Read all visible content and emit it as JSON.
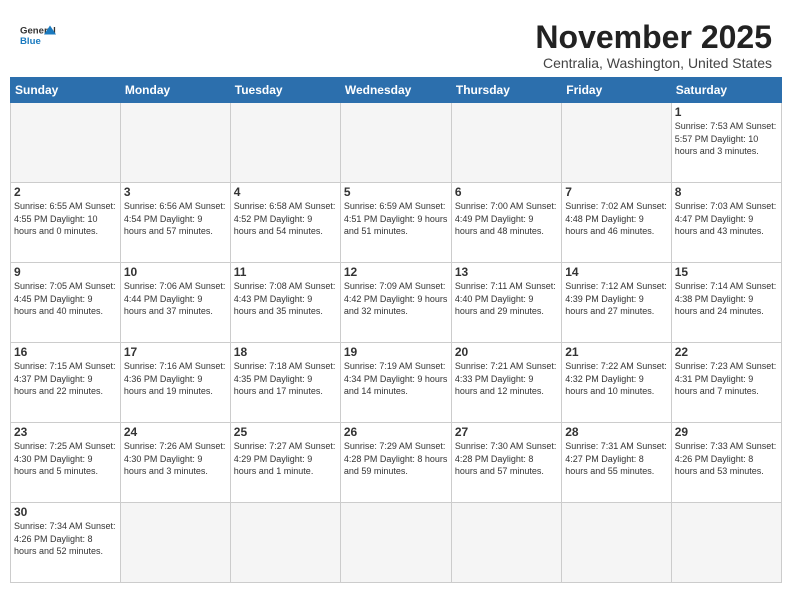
{
  "header": {
    "logo_general": "General",
    "logo_blue": "Blue",
    "month_title": "November 2025",
    "subtitle": "Centralia, Washington, United States"
  },
  "weekdays": [
    "Sunday",
    "Monday",
    "Tuesday",
    "Wednesday",
    "Thursday",
    "Friday",
    "Saturday"
  ],
  "weeks": [
    [
      {
        "day": "",
        "info": ""
      },
      {
        "day": "",
        "info": ""
      },
      {
        "day": "",
        "info": ""
      },
      {
        "day": "",
        "info": ""
      },
      {
        "day": "",
        "info": ""
      },
      {
        "day": "",
        "info": ""
      },
      {
        "day": "1",
        "info": "Sunrise: 7:53 AM\nSunset: 5:57 PM\nDaylight: 10 hours and 3 minutes."
      }
    ],
    [
      {
        "day": "2",
        "info": "Sunrise: 6:55 AM\nSunset: 4:55 PM\nDaylight: 10 hours and 0 minutes."
      },
      {
        "day": "3",
        "info": "Sunrise: 6:56 AM\nSunset: 4:54 PM\nDaylight: 9 hours and 57 minutes."
      },
      {
        "day": "4",
        "info": "Sunrise: 6:58 AM\nSunset: 4:52 PM\nDaylight: 9 hours and 54 minutes."
      },
      {
        "day": "5",
        "info": "Sunrise: 6:59 AM\nSunset: 4:51 PM\nDaylight: 9 hours and 51 minutes."
      },
      {
        "day": "6",
        "info": "Sunrise: 7:00 AM\nSunset: 4:49 PM\nDaylight: 9 hours and 48 minutes."
      },
      {
        "day": "7",
        "info": "Sunrise: 7:02 AM\nSunset: 4:48 PM\nDaylight: 9 hours and 46 minutes."
      },
      {
        "day": "8",
        "info": "Sunrise: 7:03 AM\nSunset: 4:47 PM\nDaylight: 9 hours and 43 minutes."
      }
    ],
    [
      {
        "day": "9",
        "info": "Sunrise: 7:05 AM\nSunset: 4:45 PM\nDaylight: 9 hours and 40 minutes."
      },
      {
        "day": "10",
        "info": "Sunrise: 7:06 AM\nSunset: 4:44 PM\nDaylight: 9 hours and 37 minutes."
      },
      {
        "day": "11",
        "info": "Sunrise: 7:08 AM\nSunset: 4:43 PM\nDaylight: 9 hours and 35 minutes."
      },
      {
        "day": "12",
        "info": "Sunrise: 7:09 AM\nSunset: 4:42 PM\nDaylight: 9 hours and 32 minutes."
      },
      {
        "day": "13",
        "info": "Sunrise: 7:11 AM\nSunset: 4:40 PM\nDaylight: 9 hours and 29 minutes."
      },
      {
        "day": "14",
        "info": "Sunrise: 7:12 AM\nSunset: 4:39 PM\nDaylight: 9 hours and 27 minutes."
      },
      {
        "day": "15",
        "info": "Sunrise: 7:14 AM\nSunset: 4:38 PM\nDaylight: 9 hours and 24 minutes."
      }
    ],
    [
      {
        "day": "16",
        "info": "Sunrise: 7:15 AM\nSunset: 4:37 PM\nDaylight: 9 hours and 22 minutes."
      },
      {
        "day": "17",
        "info": "Sunrise: 7:16 AM\nSunset: 4:36 PM\nDaylight: 9 hours and 19 minutes."
      },
      {
        "day": "18",
        "info": "Sunrise: 7:18 AM\nSunset: 4:35 PM\nDaylight: 9 hours and 17 minutes."
      },
      {
        "day": "19",
        "info": "Sunrise: 7:19 AM\nSunset: 4:34 PM\nDaylight: 9 hours and 14 minutes."
      },
      {
        "day": "20",
        "info": "Sunrise: 7:21 AM\nSunset: 4:33 PM\nDaylight: 9 hours and 12 minutes."
      },
      {
        "day": "21",
        "info": "Sunrise: 7:22 AM\nSunset: 4:32 PM\nDaylight: 9 hours and 10 minutes."
      },
      {
        "day": "22",
        "info": "Sunrise: 7:23 AM\nSunset: 4:31 PM\nDaylight: 9 hours and 7 minutes."
      }
    ],
    [
      {
        "day": "23",
        "info": "Sunrise: 7:25 AM\nSunset: 4:30 PM\nDaylight: 9 hours and 5 minutes."
      },
      {
        "day": "24",
        "info": "Sunrise: 7:26 AM\nSunset: 4:30 PM\nDaylight: 9 hours and 3 minutes."
      },
      {
        "day": "25",
        "info": "Sunrise: 7:27 AM\nSunset: 4:29 PM\nDaylight: 9 hours and 1 minute."
      },
      {
        "day": "26",
        "info": "Sunrise: 7:29 AM\nSunset: 4:28 PM\nDaylight: 8 hours and 59 minutes."
      },
      {
        "day": "27",
        "info": "Sunrise: 7:30 AM\nSunset: 4:28 PM\nDaylight: 8 hours and 57 minutes."
      },
      {
        "day": "28",
        "info": "Sunrise: 7:31 AM\nSunset: 4:27 PM\nDaylight: 8 hours and 55 minutes."
      },
      {
        "day": "29",
        "info": "Sunrise: 7:33 AM\nSunset: 4:26 PM\nDaylight: 8 hours and 53 minutes."
      }
    ],
    [
      {
        "day": "30",
        "info": "Sunrise: 7:34 AM\nSunset: 4:26 PM\nDaylight: 8 hours and 52 minutes."
      },
      {
        "day": "",
        "info": ""
      },
      {
        "day": "",
        "info": ""
      },
      {
        "day": "",
        "info": ""
      },
      {
        "day": "",
        "info": ""
      },
      {
        "day": "",
        "info": ""
      },
      {
        "day": "",
        "info": ""
      }
    ]
  ]
}
